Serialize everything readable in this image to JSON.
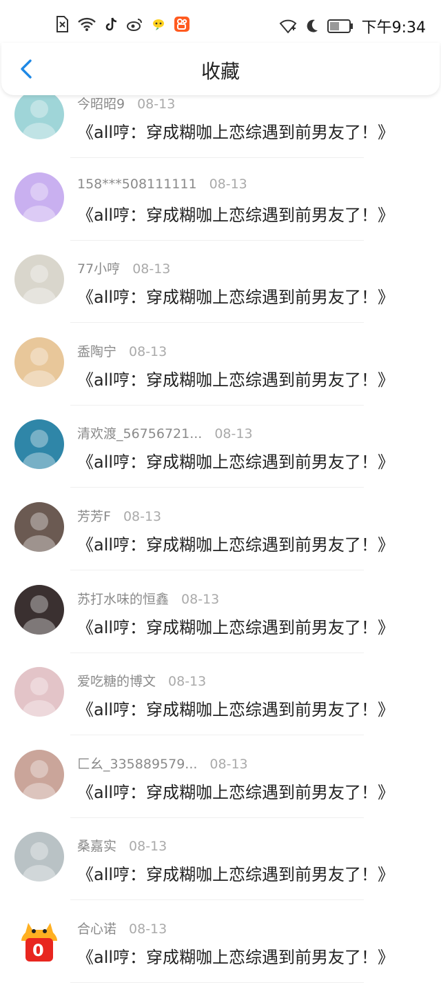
{
  "status_bar": {
    "time": "下午9:34"
  },
  "header": {
    "title": "收藏"
  },
  "items": [
    {
      "user": "今昭昭9",
      "date": "08-13",
      "title": "《all哼：穿成糊咖上恋综遇到前男友了！》",
      "avatar_color": "#9fd5d8"
    },
    {
      "user": "158***508111111",
      "date": "08-13",
      "title": "《all哼：穿成糊咖上恋综遇到前男友了！》",
      "avatar_color": "#c9b0f0"
    },
    {
      "user": "77小哼",
      "date": "08-13",
      "title": "《all哼：穿成糊咖上恋综遇到前男友了！》",
      "avatar_color": "#d9d6cc"
    },
    {
      "user": "盉陶宁",
      "date": "08-13",
      "title": "《all哼：穿成糊咖上恋综遇到前男友了！》",
      "avatar_color": "#e8c79a"
    },
    {
      "user": "清欢渡_56756721...",
      "date": "08-13",
      "title": "《all哼：穿成糊咖上恋综遇到前男友了！》",
      "avatar_color": "#2f86a8"
    },
    {
      "user": "芳芳F",
      "date": "08-13",
      "title": "《all哼：穿成糊咖上恋综遇到前男友了！》",
      "avatar_color": "#6b5a52"
    },
    {
      "user": "苏打水味的恒鑫",
      "date": "08-13",
      "title": "《all哼：穿成糊咖上恋综遇到前男友了！》",
      "avatar_color": "#3a3030"
    },
    {
      "user": "爱吃糖的博文",
      "date": "08-13",
      "title": "《all哼：穿成糊咖上恋综遇到前男友了！》",
      "avatar_color": "#e3c4c8"
    },
    {
      "user": "匚幺_335889579...",
      "date": "08-13",
      "title": "《all哼：穿成糊咖上恋综遇到前男友了！》",
      "avatar_color": "#caa59a"
    },
    {
      "user": "桑嘉实",
      "date": "08-13",
      "title": "《all哼：穿成糊咖上恋综遇到前男友了！》",
      "avatar_color": "#b9c2c5"
    },
    {
      "user": "合心诺",
      "date": "08-13",
      "title": "《all哼：穿成糊咖上恋综遇到前男友了！》",
      "avatar_color": "#ffffff",
      "avatar_badge": "0"
    }
  ]
}
